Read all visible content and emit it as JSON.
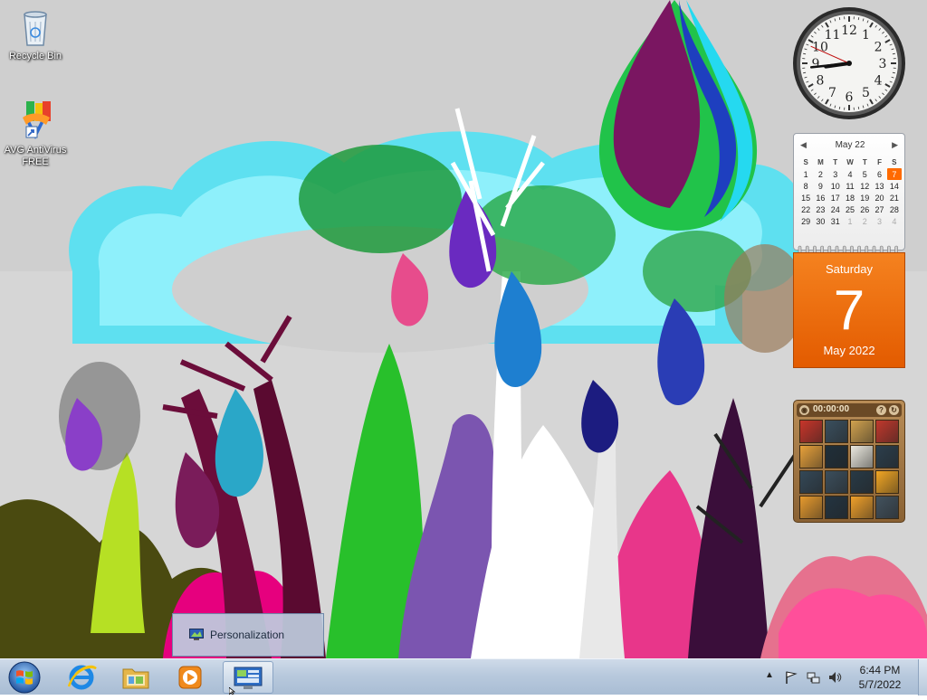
{
  "desktop": {
    "icons": [
      {
        "label": "Recycle Bin",
        "icon": "recycle-bin-icon"
      },
      {
        "label": "AVG AntiVirus FREE",
        "icon": "avg-antivirus-icon"
      }
    ]
  },
  "gadgets": {
    "clock": {
      "hour": 8,
      "minute": 44,
      "second": 49,
      "numerals": [
        "12",
        "1",
        "2",
        "3",
        "4",
        "5",
        "6",
        "7",
        "8",
        "9",
        "10",
        "11"
      ]
    },
    "calendar": {
      "month_title": "May 22",
      "weekday_headers": [
        "S",
        "M",
        "T",
        "W",
        "T",
        "F",
        "S"
      ],
      "weeks": [
        [
          "1",
          "2",
          "3",
          "4",
          "5",
          "6",
          "7"
        ],
        [
          "8",
          "9",
          "10",
          "11",
          "12",
          "13",
          "14"
        ],
        [
          "15",
          "16",
          "17",
          "18",
          "19",
          "20",
          "21"
        ],
        [
          "22",
          "23",
          "24",
          "25",
          "26",
          "27",
          "28"
        ],
        [
          "29",
          "30",
          "31",
          "1",
          "2",
          "3",
          "4"
        ]
      ],
      "today": "7",
      "weekday": "Saturday",
      "day_number": "7",
      "month_year": "May 2022",
      "accent_color": "#f26b0f"
    },
    "puzzle": {
      "timer": "00:00:00",
      "help_label": "?",
      "shuffle_label": "↻",
      "tile_colors": [
        "#c8352a",
        "#3a4f5e",
        "#d1a24e",
        "#c0382c",
        "#e8a13a",
        "#1f2f3a",
        "#eceae0",
        "#2b3e4c",
        "#344857",
        "#3b4e5c",
        "#283a46",
        "#f2a623",
        "#e79a2d",
        "#233441",
        "#f0a02a",
        "#42525e"
      ]
    }
  },
  "popup": {
    "label": "Personalization"
  },
  "taskbar": {
    "pinned": [
      {
        "name": "internet-explorer-icon"
      },
      {
        "name": "file-explorer-icon"
      },
      {
        "name": "media-player-icon"
      },
      {
        "name": "control-panel-icon"
      }
    ],
    "tray": {
      "time": "6:44 PM",
      "date": "5/7/2022"
    }
  }
}
